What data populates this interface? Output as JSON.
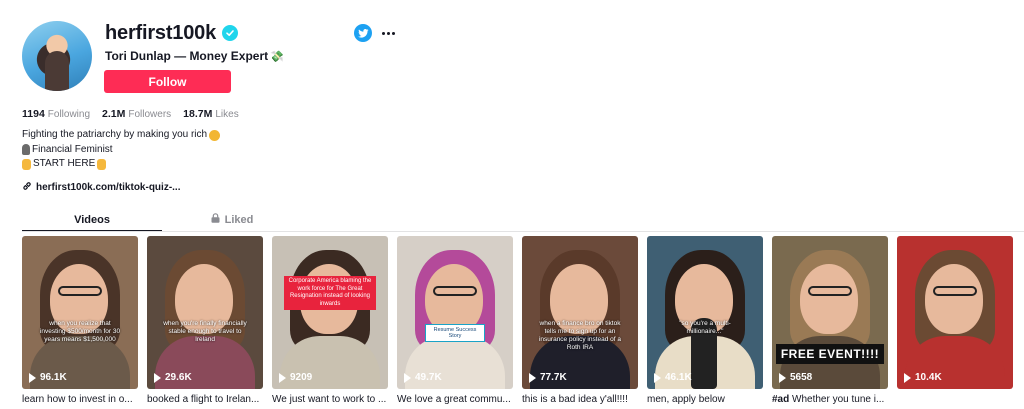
{
  "profile": {
    "username": "herfirst100k",
    "display_name": "Tori Dunlap — Money Expert",
    "follow_label": "Follow",
    "icons": {
      "verified": "verified-badge-icon",
      "share": "twitter-icon",
      "more": "more-options-icon",
      "money": "money-with-wings-icon"
    }
  },
  "stats": {
    "following_count": "1194",
    "following_label": "Following",
    "followers_count": "2.1M",
    "followers_label": "Followers",
    "likes_count": "18.7M",
    "likes_label": "Likes"
  },
  "bio": {
    "line1": "Fighting the patriarchy by making you rich",
    "line2": "Financial Feminist",
    "line3": "START HERE"
  },
  "link": {
    "text": "herfirst100k.com/tiktok-quiz-..."
  },
  "tabs": {
    "videos": "Videos",
    "liked": "Liked"
  },
  "videos": [
    {
      "views": "96.1K",
      "caption": "learn how to invest in o...",
      "overlay": "when you realize that investing $500/month for 30 years means $1,500,000",
      "bg": "#8a6d55"
    },
    {
      "views": "29.6K",
      "caption": "booked a flight to Irelan...",
      "overlay": "when you're finally financially stable enough to travel to Ireland",
      "bg": "#5b4a3e"
    },
    {
      "views": "9209",
      "caption": "We just want to work to ...",
      "banner": "Corporate America blaming the work force for The Great Resignation instead of looking inwards",
      "bg": "#c7c0b5"
    },
    {
      "views": "49.7K",
      "caption": "We love a great commu...",
      "label": "Resume Success Story",
      "bg": "#d6cfc7"
    },
    {
      "views": "77.7K",
      "caption": "this is a bad idea y'all!!!!",
      "overlay": "when a finance bro on tiktok tells me to sign up for an insurance policy instead of a Roth IRA",
      "bg": "#6b4a3a"
    },
    {
      "views": "46.1K",
      "caption": "men, apply below",
      "overlay": "\"so you're a multi-millionaire...\"",
      "bg": "#3f5f73"
    },
    {
      "views": "5658",
      "caption": "#ad Whether you tune i...",
      "promo": "FREE EVENT!!!!",
      "bg": "#7a6a4f"
    },
    {
      "views": "10.4K",
      "caption": "",
      "bg": "#b8312f"
    }
  ]
}
